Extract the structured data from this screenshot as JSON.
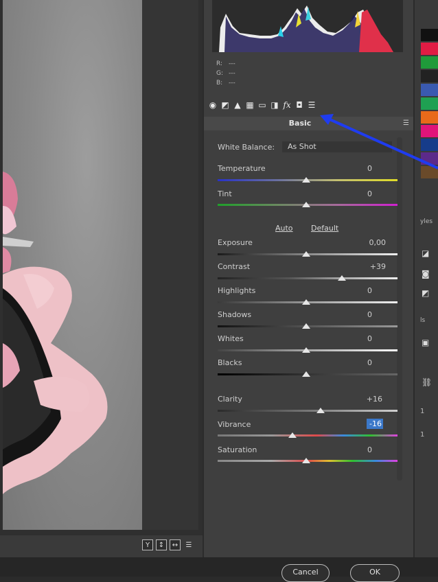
{
  "readout": {
    "r_label": "R:",
    "g_label": "G:",
    "b_label": "B:",
    "r": "---",
    "g": "---",
    "b": "---"
  },
  "panel": {
    "title": "Basic",
    "menu_icon": "panel-menu-icon"
  },
  "toolbar_icons": [
    "basic-icon",
    "tone-curve-icon",
    "detail-icon",
    "hsl-icon",
    "split-toning-icon",
    "lens-corrections-icon",
    "effects-fx-icon",
    "camera-calibration-icon",
    "presets-icon"
  ],
  "white_balance": {
    "label": "White Balance:",
    "value": "As Shot"
  },
  "temperature": {
    "label": "Temperature",
    "value": "0"
  },
  "tint": {
    "label": "Tint",
    "value": "0"
  },
  "auto_link": "Auto",
  "default_link": "Default",
  "exposure": {
    "label": "Exposure",
    "value": "0,00"
  },
  "contrast": {
    "label": "Contrast",
    "value": "+39"
  },
  "highlights": {
    "label": "Highlights",
    "value": "0"
  },
  "shadows": {
    "label": "Shadows",
    "value": "0"
  },
  "whites": {
    "label": "Whites",
    "value": "0"
  },
  "blacks": {
    "label": "Blacks",
    "value": "0"
  },
  "clarity": {
    "label": "Clarity",
    "value": "+16"
  },
  "vibrance": {
    "label": "Vibrance",
    "value": "-16"
  },
  "saturation": {
    "label": "Saturation",
    "value": "0"
  },
  "footer_view_buttons": [
    "Y",
    "↕",
    "↔"
  ],
  "right_strip": {
    "text1": "yles",
    "text2": "ls",
    "num1": "1",
    "num2": "1"
  },
  "bottom_buttons": {
    "cancel": "Cancel",
    "ok": "OK"
  },
  "colors": {
    "panel_bg": "#3f3f3f",
    "accent_blue": "#1f3cf0",
    "vibrance_highlight": "#3b78c9"
  }
}
